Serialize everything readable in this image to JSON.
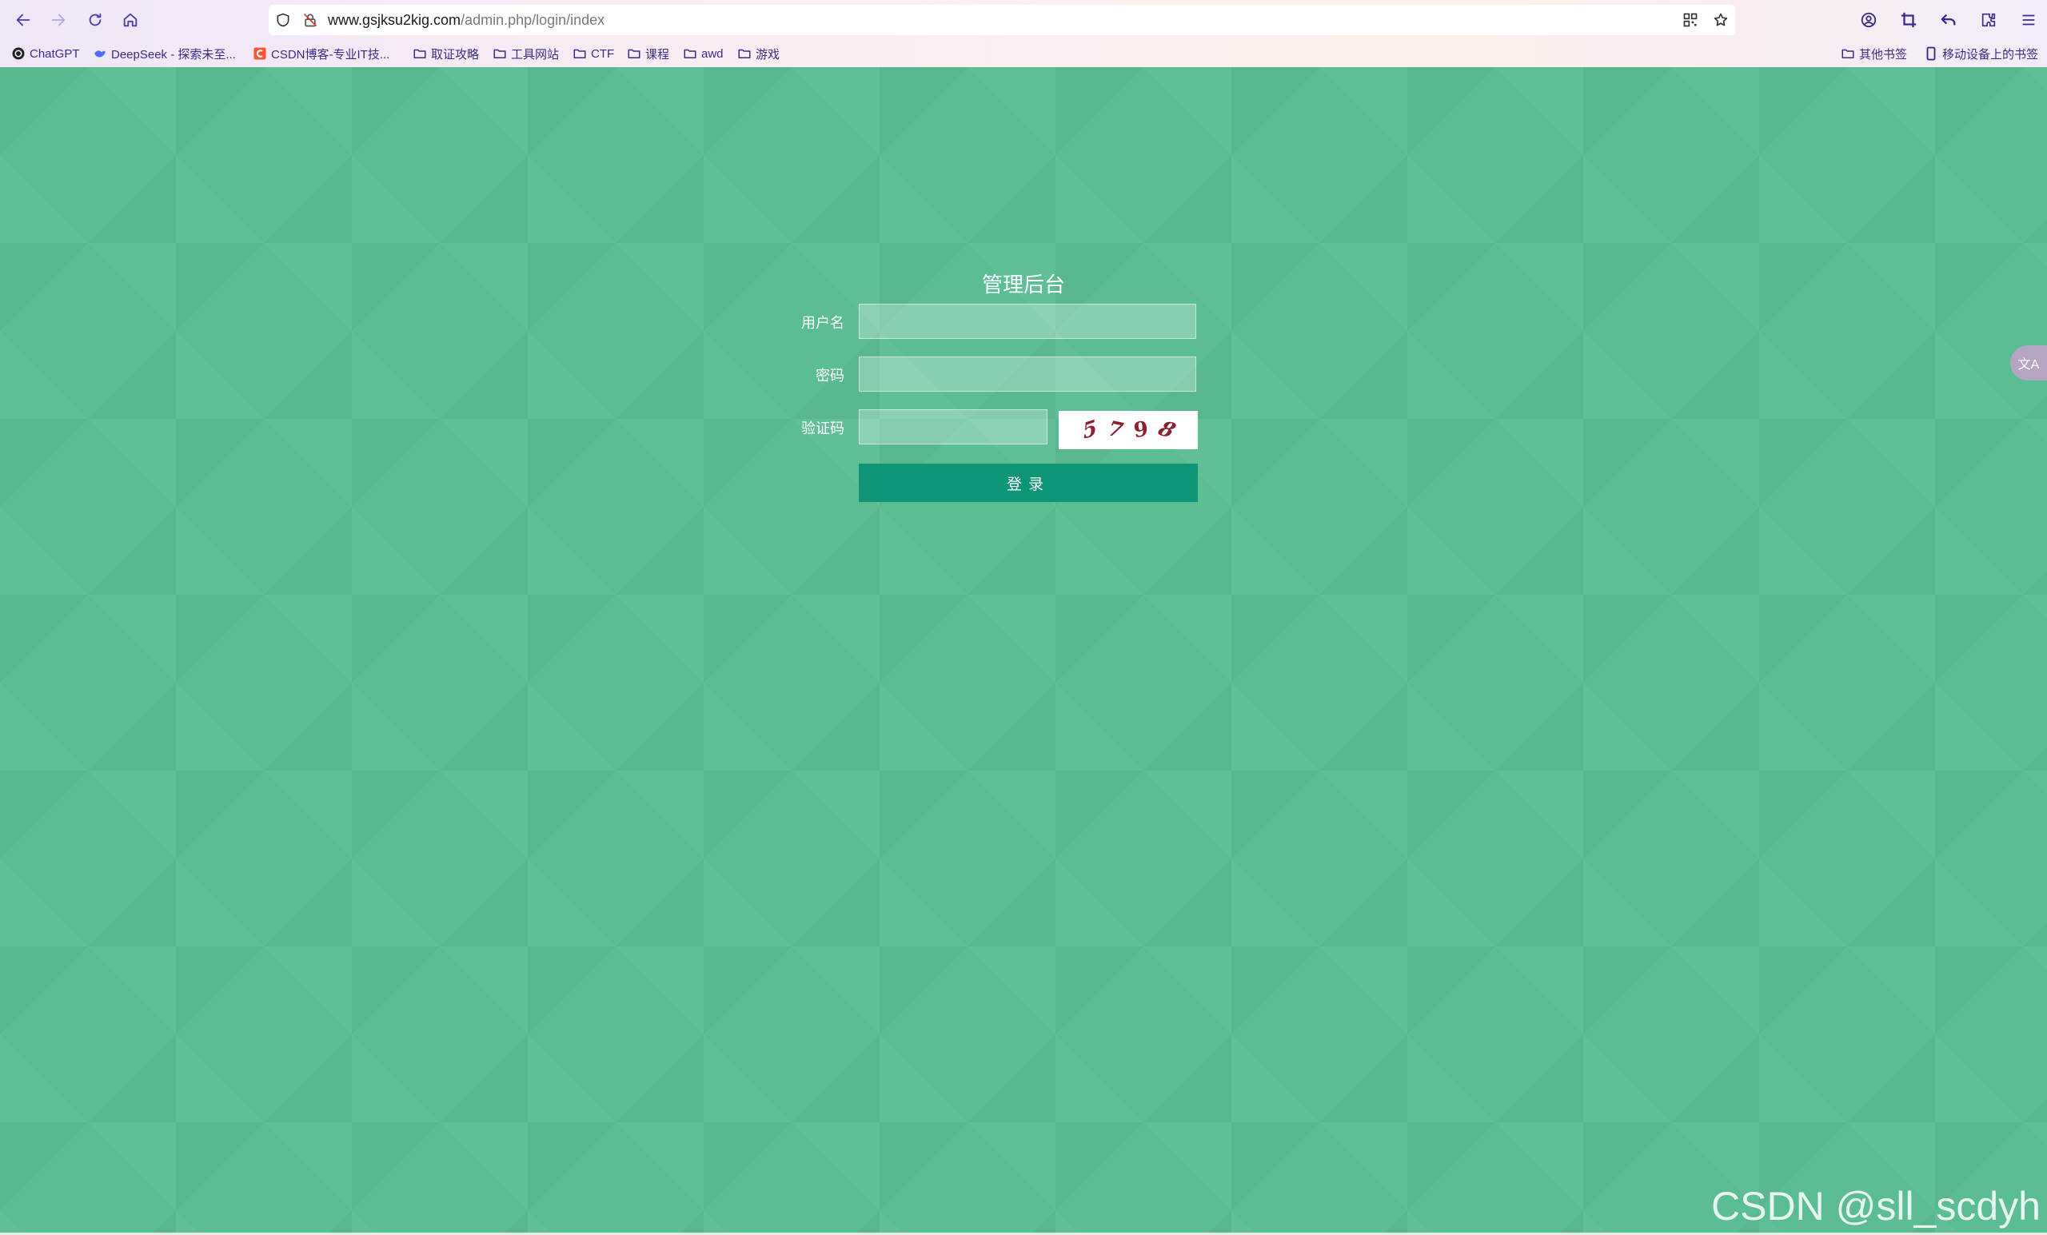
{
  "browser": {
    "url_host": "www.gsjksu2kig.com",
    "url_path": "/admin.php/login/index",
    "bookmarks": [
      {
        "label": "ChatGPT",
        "icon": "chatgpt-icon"
      },
      {
        "label": "DeepSeek - 探索未至...",
        "icon": "deepseek-icon"
      },
      {
        "label": "CSDN博客-专业IT技...",
        "icon": "csdn-icon"
      },
      {
        "label": "取证攻略",
        "icon": "folder-icon"
      },
      {
        "label": "工具网站",
        "icon": "folder-icon"
      },
      {
        "label": "CTF",
        "icon": "folder-icon"
      },
      {
        "label": "课程",
        "icon": "folder-icon"
      },
      {
        "label": "awd",
        "icon": "folder-icon"
      },
      {
        "label": "游戏",
        "icon": "folder-icon"
      }
    ],
    "bookmarks_right": [
      {
        "label": "其他书签",
        "icon": "folder-icon"
      },
      {
        "label": "移动设备上的书签",
        "icon": "mobile-icon"
      }
    ]
  },
  "login": {
    "title": "管理后台",
    "username_label": "用户名",
    "password_label": "密码",
    "captcha_label": "验证码",
    "captcha_chars": [
      "5",
      "7",
      "9",
      "8"
    ],
    "submit_label": "登录"
  },
  "overlay": {
    "translate_icon_text": "文A",
    "watermark": "CSDN @sll_scdyh"
  },
  "colors": {
    "page_bg": "#5bbd94",
    "button_bg": "#0f9477",
    "captcha_text": "#8a2030",
    "bookmark_text": "#3a2a8a"
  }
}
